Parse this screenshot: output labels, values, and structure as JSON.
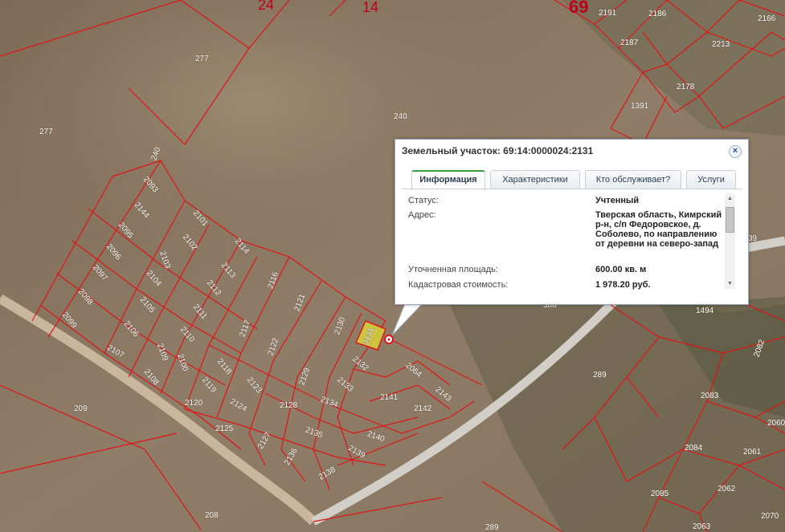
{
  "map": {
    "quarter_labels": [
      "24",
      "14",
      "69"
    ],
    "parcel_labels": [
      "2191",
      "2186",
      "2166",
      "2187",
      "2213",
      "277",
      "2178",
      "1391",
      "240",
      "277",
      "240",
      "2093",
      "2144",
      "2101",
      "2095",
      "2102",
      "2114",
      "2096",
      "2103",
      "2113",
      "2097",
      "2104",
      "2112",
      "2116",
      "2098",
      "2105",
      "2111",
      "2121",
      "2099",
      "2106",
      "2110",
      "2117",
      "2130",
      "2107",
      "2109",
      "2122",
      "2131",
      "2100",
      "2118",
      "2132",
      "2064",
      "2108",
      "2119",
      "2123",
      "2129",
      "2133",
      "2141",
      "2120",
      "2124",
      "2128",
      "2134",
      "2142",
      "2143",
      "2125",
      "2127",
      "2135",
      "2140",
      "2136",
      "2139",
      "2138",
      "209",
      "208",
      "289",
      "289",
      "2083",
      "2084",
      "2061",
      "2085",
      "2062",
      "2063",
      "2070",
      "1494",
      "2082",
      "2060",
      "39",
      "388"
    ],
    "highlighted_parcel": "2131"
  },
  "popup": {
    "title": "Земельный участок: 69:14:0000024:2131",
    "close_label": "×",
    "tabs": [
      {
        "label": "Информация",
        "active": true
      },
      {
        "label": "Характеристики",
        "active": false
      },
      {
        "label": "Кто обслуживает?",
        "active": false
      },
      {
        "label": "Услуги",
        "active": false
      }
    ],
    "rows": [
      {
        "key": "Статус:",
        "value": "Учтенный"
      },
      {
        "key": "Адрес:",
        "value": "Тверская область, Кимрский р-н, с/п Федоровское, д. Соболево, по направлению от деревни на северо-запад"
      },
      {
        "key": "Уточненная площадь:",
        "value": "600.00 кв. м"
      },
      {
        "key": "Кадастровая стоимость:",
        "value": "1 978.20 руб."
      }
    ],
    "scroll_up": "▲",
    "scroll_down": "▼"
  }
}
